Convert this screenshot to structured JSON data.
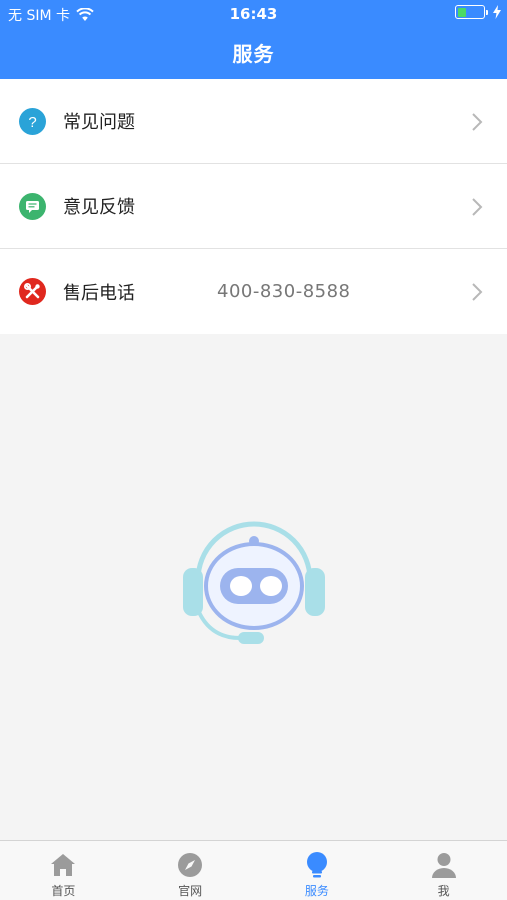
{
  "status_bar": {
    "carrier": "无 SIM 卡",
    "time": "16:43",
    "battery_level": 0.35
  },
  "header": {
    "title": "服务"
  },
  "service_list": [
    {
      "label": "常见问题",
      "value": "",
      "icon": "question-icon",
      "color": "#2aa3d8"
    },
    {
      "label": "意见反馈",
      "value": "",
      "icon": "feedback-icon",
      "color": "#3cb46e"
    },
    {
      "label": "售后电话",
      "value": "400-830-8588",
      "icon": "repair-tools-icon",
      "color": "#e0281e"
    }
  ],
  "tabbar": {
    "tabs": [
      {
        "label": "首页",
        "icon": "home-icon",
        "active": false
      },
      {
        "label": "官网",
        "icon": "compass-icon",
        "active": false
      },
      {
        "label": "服务",
        "icon": "lightbulb-icon",
        "active": true
      },
      {
        "label": "我",
        "icon": "user-icon",
        "active": false
      }
    ],
    "active_color": "#3a8bff",
    "inactive_color": "#9b9b9b"
  },
  "colors": {
    "header_bg": "#3a8bff",
    "page_bg": "#f4f4f4"
  }
}
